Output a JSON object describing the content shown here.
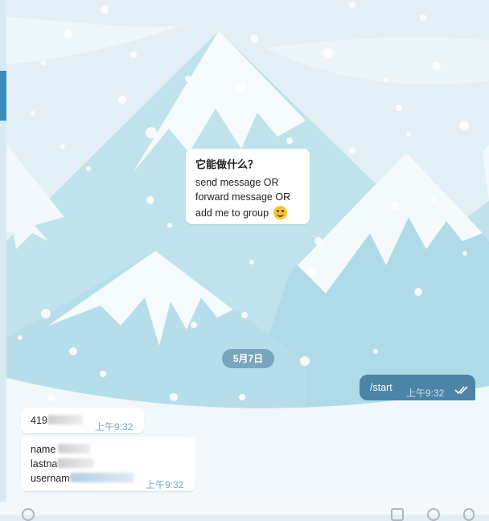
{
  "bot_card": {
    "title": "它能做什么？",
    "lines": [
      "send message  OR",
      "forward message  OR",
      "add me to group"
    ],
    "emoji": "smiling-face-emoji"
  },
  "date_separator": "5月7日",
  "outgoing": {
    "text": "/start",
    "time": "上午9:32",
    "status_icon": "double-check-icon"
  },
  "incoming_1": {
    "text_visible": "419",
    "time": "上午9:32"
  },
  "incoming_2": {
    "lines": [
      "name",
      "lastna",
      "usernam"
    ],
    "time": "上午9:32"
  },
  "composer": {
    "placeholder": "",
    "icons": [
      "attach-icon",
      "bot-commands-icon",
      "emoji-icon",
      "microphone-icon"
    ]
  },
  "colors": {
    "outgoing_bubble": "#4c83a6",
    "date_pill": "#6a95ae",
    "time_incoming": "#78a9c5",
    "accent_bar": "#3c8cc4"
  }
}
